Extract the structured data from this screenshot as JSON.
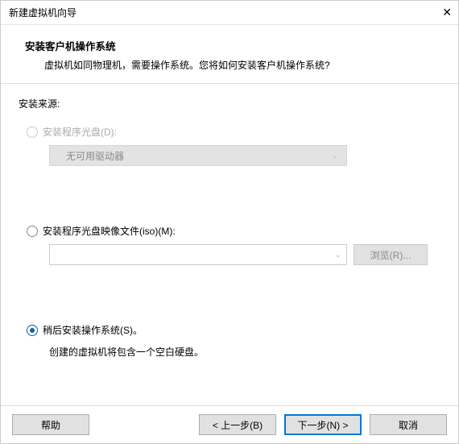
{
  "titlebar": {
    "title": "新建虚拟机向导"
  },
  "header": {
    "title": "安装客户机操作系统",
    "description": "虚拟机如同物理机，需要操作系统。您将如何安装客户机操作系统?"
  },
  "body": {
    "sourceLabel": "安装来源:",
    "option1": {
      "label": "安装程序光盘(D):",
      "dropdownText": "无可用驱动器"
    },
    "option2": {
      "label": "安装程序光盘映像文件(iso)(M):",
      "browseLabel": "浏览(R)..."
    },
    "option3": {
      "label": "稍后安装操作系统(S)。",
      "note": "创建的虚拟机将包含一个空白硬盘。"
    }
  },
  "footer": {
    "help": "帮助",
    "back": "< 上一步(B)",
    "next": "下一步(N) >",
    "cancel": "取消"
  }
}
